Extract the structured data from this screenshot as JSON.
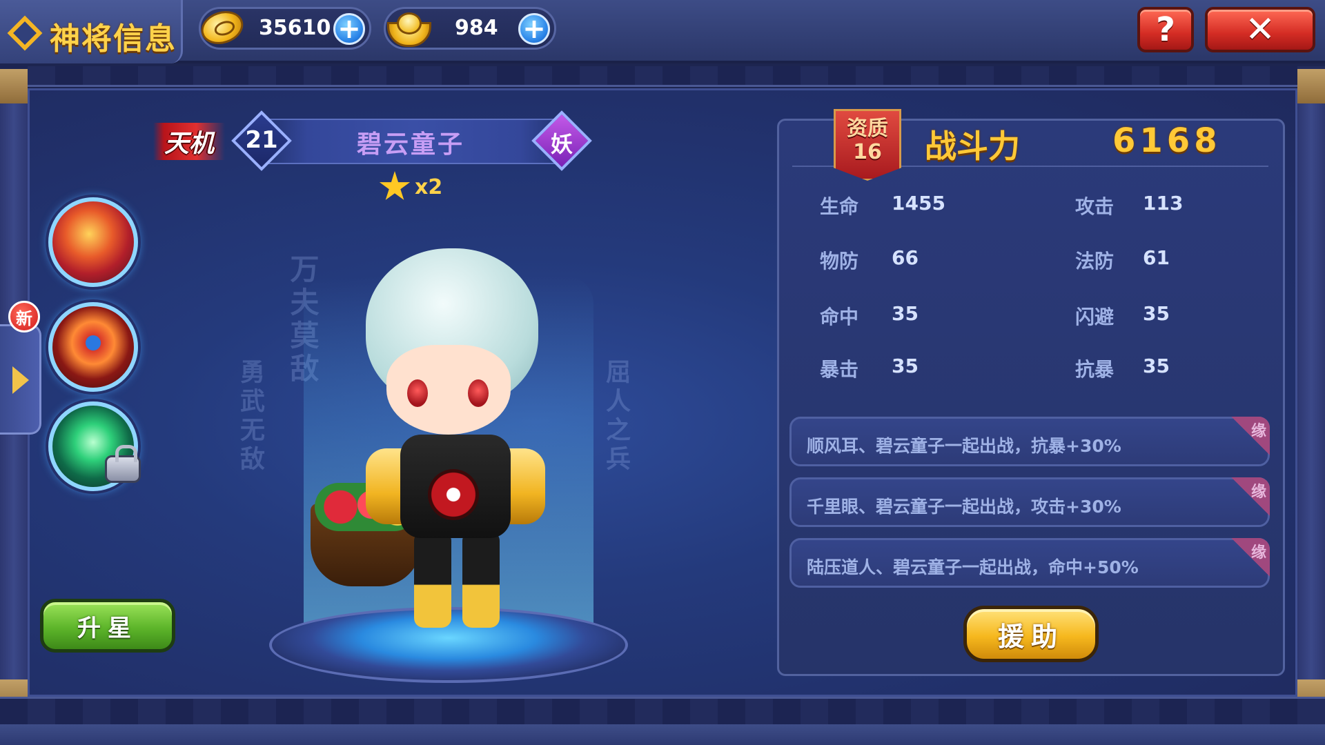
{
  "header": {
    "title": "神将信息",
    "currencies": [
      {
        "name": "coin",
        "value": "35610",
        "icon": "coin-icon"
      },
      {
        "name": "ingot",
        "value": "984",
        "icon": "gold-ingot-icon"
      }
    ],
    "help_label": "?",
    "close_label": "✕"
  },
  "hero": {
    "faction": "天机",
    "level": "21",
    "name": "碧云童子",
    "race": "妖",
    "stars": "x2"
  },
  "left": {
    "new_badge": "新",
    "upgrade_star_label": "升星"
  },
  "scrolls": {
    "left1": "万夫莫敌",
    "left2": "勇武无敌",
    "right1": "屈人之兵"
  },
  "stats": {
    "quality_label": "资质",
    "quality_value": "16",
    "power_label": "战斗力",
    "power_value": "6168",
    "items": [
      {
        "label": "生命",
        "value": "1455"
      },
      {
        "label": "攻击",
        "value": "113"
      },
      {
        "label": "物防",
        "value": "66"
      },
      {
        "label": "法防",
        "value": "61"
      },
      {
        "label": "命中",
        "value": "35"
      },
      {
        "label": "闪避",
        "value": "35"
      },
      {
        "label": "暴击",
        "value": "35"
      },
      {
        "label": "抗暴",
        "value": "35"
      }
    ]
  },
  "fates": [
    {
      "text": "顺风耳、碧云童子一起出战，抗暴+30%",
      "tag": "缘"
    },
    {
      "text": "千里眼、碧云童子一起出战，攻击+30%",
      "tag": "缘"
    },
    {
      "text": "陆压道人、碧云童子一起出战，命中+50%",
      "tag": "缘"
    }
  ],
  "assist_label": "援助",
  "colors": {
    "accent_gold": "#ffc937",
    "panel_blue": "#263469",
    "button_green": "#5db52a",
    "button_yellow": "#f6b81e",
    "close_red": "#d42c24"
  }
}
